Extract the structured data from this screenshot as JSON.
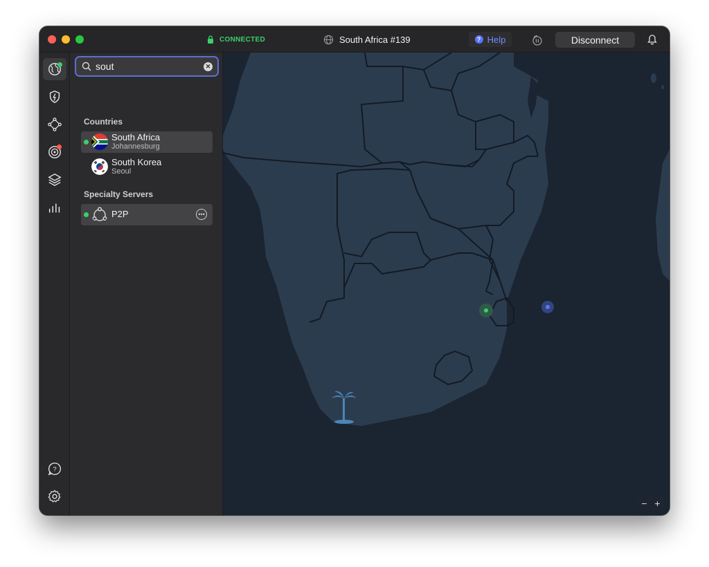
{
  "titlebar": {
    "status": "CONNECTED",
    "server": "South Africa #139",
    "help_label": "Help",
    "disconnect_label": "Disconnect"
  },
  "search": {
    "value": "sout",
    "placeholder": ""
  },
  "sections": {
    "countries": "Countries",
    "specialty": "Specialty Servers"
  },
  "countries": [
    {
      "name": "South Africa",
      "city": "Johannesburg",
      "connected": true
    },
    {
      "name": "South Korea",
      "city": "Seoul",
      "connected": false
    }
  ],
  "specialty": [
    {
      "name": "P2P"
    }
  ],
  "zoom": {
    "minus": "−",
    "plus": "+"
  },
  "colors": {
    "connected_green": "#3ccf6b",
    "accent_blue": "#5b6fd6",
    "map_land": "#2c3c4f",
    "map_water": "#1b2431"
  },
  "icons": {
    "rail": [
      "globe-icon",
      "shield-bolt-icon",
      "meshnet-icon",
      "threat-radar-icon",
      "layers-icon",
      "stats-bars-icon",
      "help-chat-icon",
      "gear-icon"
    ]
  }
}
